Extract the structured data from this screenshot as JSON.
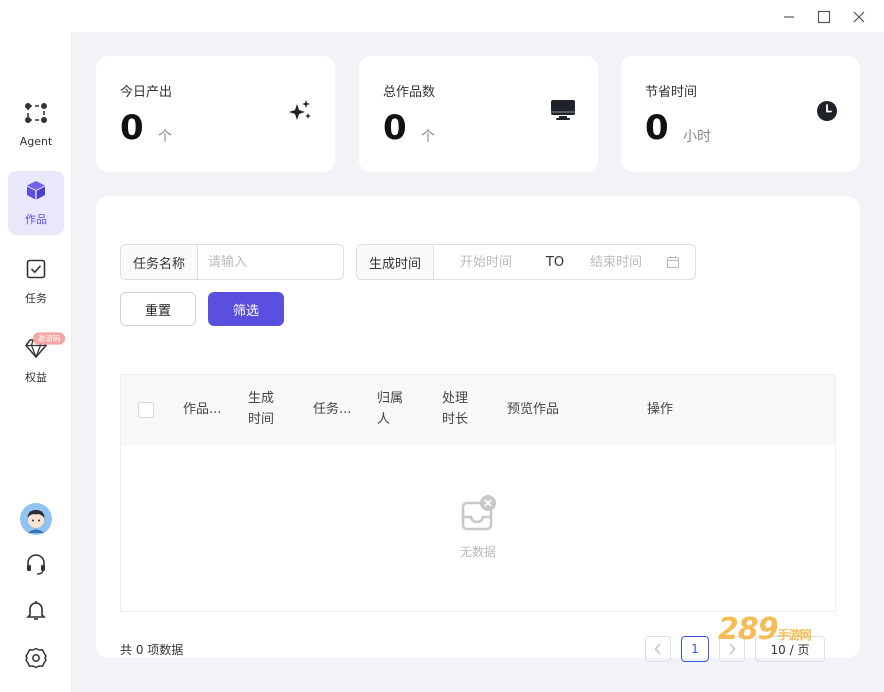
{
  "sidebar": {
    "items": [
      {
        "label": "Agent",
        "icon": "agent-nodes-icon"
      },
      {
        "label": "作品",
        "icon": "cube-icon"
      },
      {
        "label": "任务",
        "icon": "task-check-icon"
      },
      {
        "label": "权益",
        "icon": "diamond-icon",
        "badge": "邀请码"
      }
    ],
    "bottom_icons": [
      "avatar",
      "headset-icon",
      "bell-icon",
      "settings-icon"
    ]
  },
  "stats": [
    {
      "title": "今日产出",
      "value": "0",
      "unit": "个",
      "icon": "sparkle-icon"
    },
    {
      "title": "总作品数",
      "value": "0",
      "unit": "个",
      "icon": "monitor-icon"
    },
    {
      "title": "节省时间",
      "value": "0",
      "unit": "小时",
      "icon": "clock-icon"
    }
  ],
  "filters": {
    "task_name_label": "任务名称",
    "task_name_placeholder": "请输入",
    "time_label": "生成时间",
    "start_placeholder": "开始时间",
    "range_sep": "TO",
    "end_placeholder": "结束时间"
  },
  "buttons": {
    "reset": "重置",
    "filter": "筛选"
  },
  "table": {
    "columns": [
      "作品...",
      "生成\n时间",
      "任务...",
      "归属\n人",
      "处理\n时长",
      "预览作品",
      "操作"
    ],
    "empty_text": "无数据"
  },
  "footer": {
    "total": "共 0 项数据",
    "page": "1",
    "page_size": "10 / 页"
  },
  "watermark": {
    "text": "289",
    "sub": "手游网"
  },
  "colors": {
    "accent": "#5b4fe0",
    "active_bg": "#e9e8fb",
    "badge": "#f3a4a4"
  }
}
